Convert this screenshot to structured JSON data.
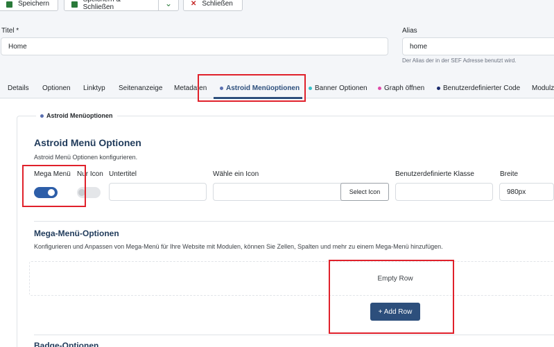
{
  "toolbar": {
    "save_label": "Speichern",
    "save_close_label": "Speichern & Schließen",
    "close_label": "Schließen"
  },
  "fields": {
    "title_label": "Titel *",
    "title_value": "Home",
    "alias_label": "Alias",
    "alias_value": "home",
    "alias_hint": "Der Alias der in der SEF Adresse benutzt wird."
  },
  "tabs": [
    {
      "label": "Details"
    },
    {
      "label": "Optionen"
    },
    {
      "label": "Linktyp"
    },
    {
      "label": "Seitenanzeige"
    },
    {
      "label": "Metadaten"
    },
    {
      "label": "Astroid Menüoptionen",
      "dot_color": "#5a6fb0"
    },
    {
      "label": "Banner Optionen",
      "dot_color": "#38c0c8"
    },
    {
      "label": "Graph öffnen",
      "dot_color": "#e04aa8"
    },
    {
      "label": "Benutzerdefinierter Code",
      "dot_color": "#1a2a6c"
    },
    {
      "label": "Modulz"
    }
  ],
  "fieldset": {
    "legend": "Astroid Menüoptionen",
    "legend_dot_color": "#5a6fb0"
  },
  "astroid": {
    "title": "Astroid Menü Optionen",
    "description": "Astroid Menü Optionen konfigurieren.",
    "mega_menu_label": "Mega Menü",
    "mega_menu_on": true,
    "icon_only_label": "Nur Icon",
    "icon_only_on": false,
    "subtitle_label": "Untertitel",
    "subtitle_value": "",
    "icon_label": "Wähle ein Icon",
    "icon_value": "",
    "select_icon_label": "Select Icon",
    "custom_class_label": "Benutzerdefinierte Klasse",
    "custom_class_value": "",
    "width_label": "Breite",
    "width_value": "980px"
  },
  "mega": {
    "title": "Mega-Menü-Optionen",
    "description": "Konfigurieren und Anpassen von Mega-Menü für Ihre Website mit Modulen, können Sie Zellen, Spalten und mehr zu einem Mega-Menü hinzufügen.",
    "empty_row": "Empty Row",
    "add_row_label": "+ Add Row"
  },
  "badge": {
    "title": "Badge-Optionen"
  },
  "colors": {
    "accent": "#2d4f7c",
    "highlight": "#e0202a",
    "save_green": "#2a7a3a",
    "close_red": "#c52827"
  }
}
